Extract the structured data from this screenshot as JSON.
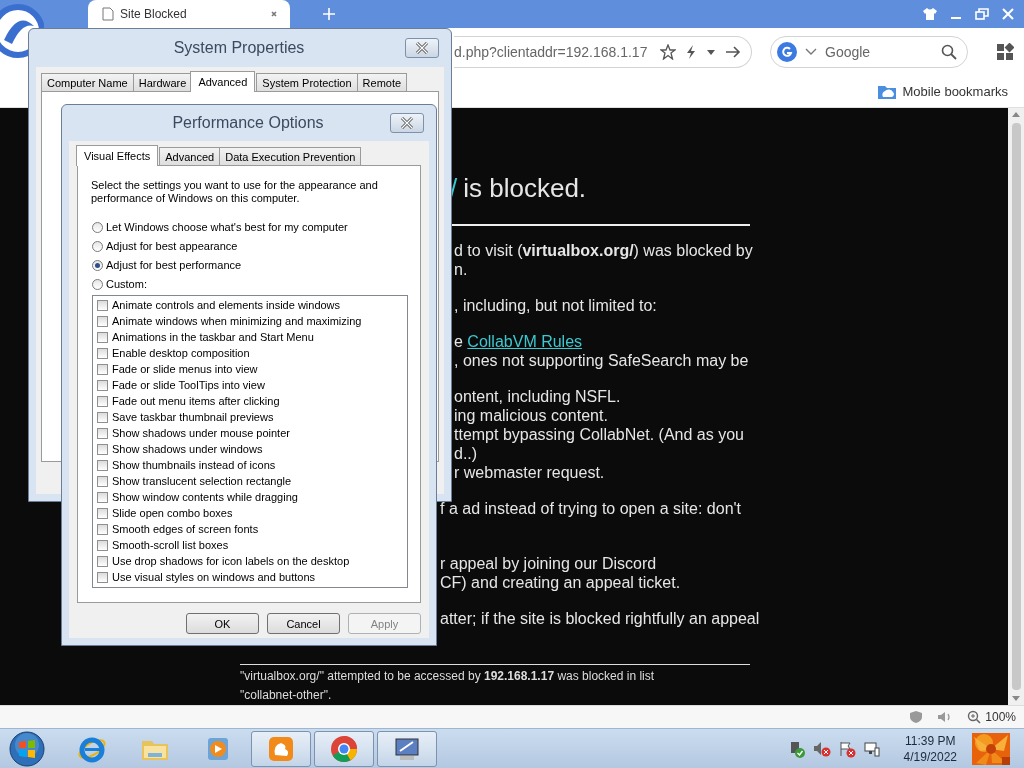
{
  "browser": {
    "tabs": [
      {
        "label": "Site Blocked",
        "selected": true
      }
    ],
    "address": "d.php?clientaddr=192.168.1.17",
    "search": {
      "placeholder": "Google"
    },
    "bookmarks": [
      "Mobile bookmarks"
    ],
    "page": {
      "heading": {
        "link": "/",
        "text": "is blocked."
      },
      "paragraphs": [
        [
          {
            "text": "d to visit (**virtualbox.org/**) was blocked by"
          },
          {
            "text": "n."
          }
        ],
        [
          {
            "text": ", including, but not limited to:"
          }
        ],
        [
          {
            "text": "e ",
            "link": "CollabVM Rules"
          },
          {
            "text": ", ones not supporting SafeSearch may be"
          }
        ],
        [
          {
            "text": "ontent, including NSFL."
          },
          {
            "text": "ing malicious content."
          },
          {
            "text": "ttempt bypassing CollabNet. (And as you"
          },
          {
            "text": "d..)"
          },
          {
            "text": "r webmaster request."
          }
        ],
        [
          {
            "text": "f a ad instead of trying to open a site: don't"
          }
        ],
        [
          {
            "text": "r appeal by joining our Discord"
          },
          {
            "text": "CF) and creating an appeal ticket."
          }
        ],
        [
          {
            "text": "atter; if the site is blocked rightfully an appeal"
          }
        ]
      ],
      "footer": [
        "\"virtualbox.org/\" attempted to be accessed by **192.168.1.17** was blocked in list",
        "\"collabnet-other\"."
      ]
    },
    "status_bar": {
      "zoom": "100%"
    }
  },
  "system_properties": {
    "title": "System Properties",
    "tabs": [
      {
        "label": "Computer Name",
        "selected": false
      },
      {
        "label": "Hardware",
        "selected": false
      },
      {
        "label": "Advanced",
        "selected": true
      },
      {
        "label": "System Protection",
        "selected": false
      },
      {
        "label": "Remote",
        "selected": false
      }
    ]
  },
  "performance_options": {
    "title": "Performance Options",
    "tabs": [
      {
        "label": "Visual Effects",
        "selected": true
      },
      {
        "label": "Advanced",
        "selected": false
      },
      {
        "label": "Data Execution Prevention",
        "selected": false
      }
    ],
    "description": "Select the settings you want to use for the appearance and performance of Windows on this computer.",
    "options": [
      {
        "label": "Let Windows choose what's best for my computer",
        "selected": false
      },
      {
        "label": "Adjust for best appearance",
        "selected": false
      },
      {
        "label": "Adjust for best performance",
        "selected": true
      },
      {
        "label": "Custom:",
        "selected": false
      }
    ],
    "effects": [
      {
        "label": "Animate controls and elements inside windows",
        "checked": false
      },
      {
        "label": "Animate windows when minimizing and maximizing",
        "checked": false
      },
      {
        "label": "Animations in the taskbar and Start Menu",
        "checked": false
      },
      {
        "label": "Enable desktop composition",
        "checked": false
      },
      {
        "label": "Fade or slide menus into view",
        "checked": false
      },
      {
        "label": "Fade or slide ToolTips into view",
        "checked": false
      },
      {
        "label": "Fade out menu items after clicking",
        "checked": false
      },
      {
        "label": "Save taskbar thumbnail previews",
        "checked": false
      },
      {
        "label": "Show shadows under mouse pointer",
        "checked": false
      },
      {
        "label": "Show shadows under windows",
        "checked": false
      },
      {
        "label": "Show thumbnails instead of icons",
        "checked": false
      },
      {
        "label": "Show translucent selection rectangle",
        "checked": false
      },
      {
        "label": "Show window contents while dragging",
        "checked": false
      },
      {
        "label": "Slide open combo boxes",
        "checked": false
      },
      {
        "label": "Smooth edges of screen fonts",
        "checked": false
      },
      {
        "label": "Smooth-scroll list boxes",
        "checked": false
      },
      {
        "label": "Use drop shadows for icon labels on the desktop",
        "checked": false
      },
      {
        "label": "Use visual styles on windows and buttons",
        "checked": false
      }
    ],
    "buttons": [
      {
        "label": "OK",
        "disabled": false
      },
      {
        "label": "Cancel",
        "disabled": false
      },
      {
        "label": "Apply",
        "disabled": true
      }
    ]
  },
  "taskbar": {
    "apps": [
      {
        "kind": "ie",
        "active": false
      },
      {
        "kind": "explorer",
        "active": false
      },
      {
        "kind": "media",
        "active": false
      },
      {
        "kind": "uc",
        "active": true
      },
      {
        "kind": "chrome",
        "active": true
      },
      {
        "kind": "remote",
        "active": true
      }
    ],
    "time": "11:39 PM",
    "date": "4/19/2022"
  }
}
